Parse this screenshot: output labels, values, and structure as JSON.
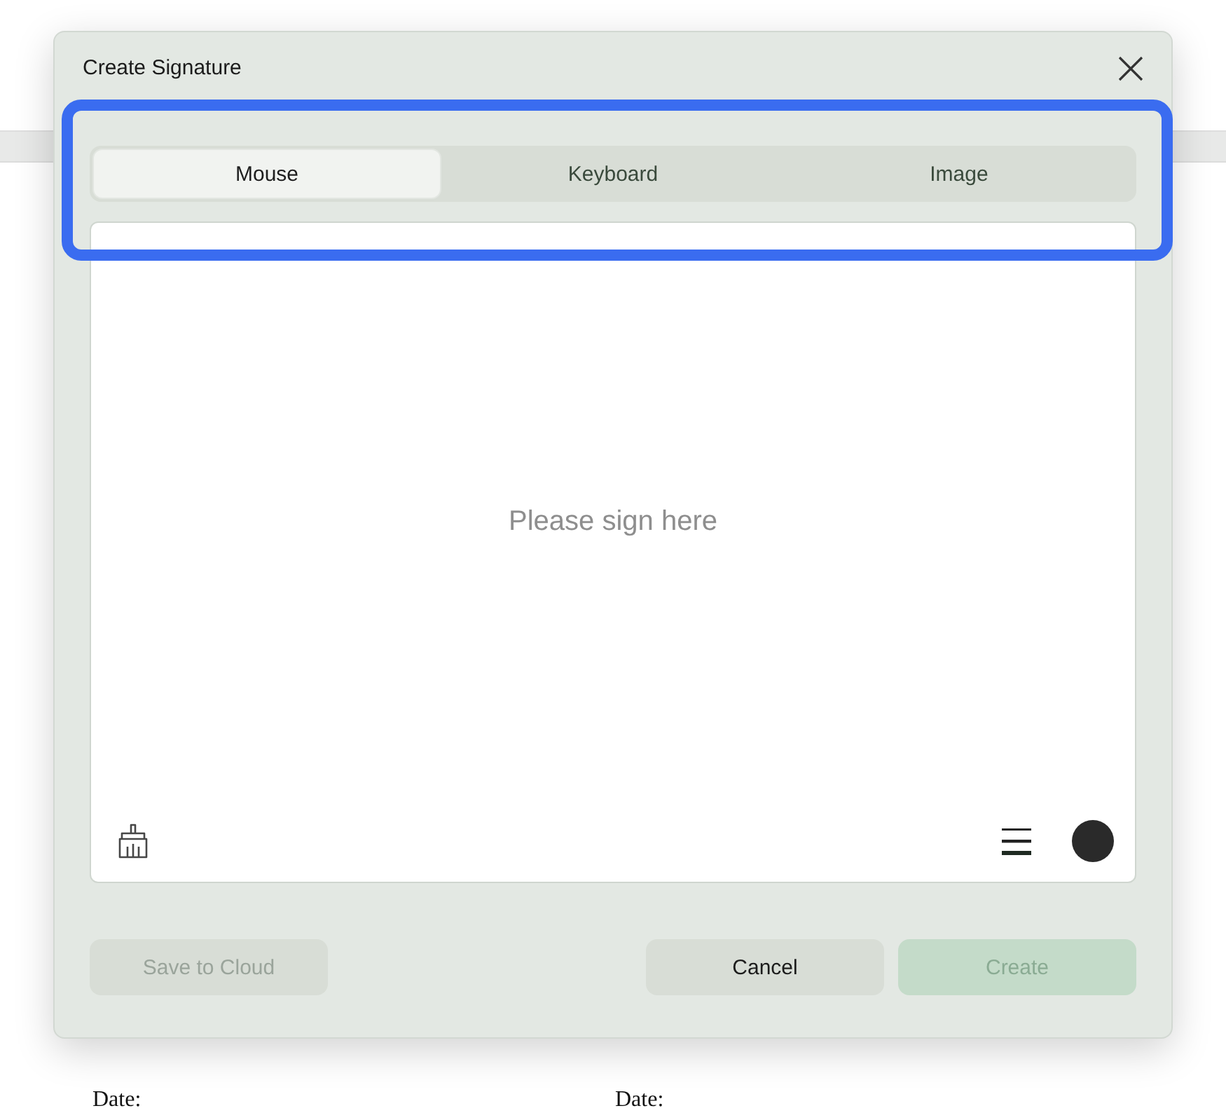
{
  "backdrop": {
    "labels": [
      "Date:",
      "Date:"
    ]
  },
  "dialog": {
    "title": "Create Signature"
  },
  "tab_bar": {
    "highlighted": true,
    "tabs": [
      {
        "label": "Mouse",
        "selected": true
      },
      {
        "label": "Keyboard",
        "selected": false
      },
      {
        "label": "Image",
        "selected": false
      }
    ]
  },
  "pad": {
    "placeholder": "Please sign here"
  },
  "buttons": [
    {
      "label": "Save to Cloud",
      "kind": "secondary",
      "disabled": true
    },
    {
      "label": "Cancel",
      "kind": "secondary",
      "disabled": false
    },
    {
      "label": "Create",
      "kind": "primary",
      "disabled": true
    }
  ]
}
